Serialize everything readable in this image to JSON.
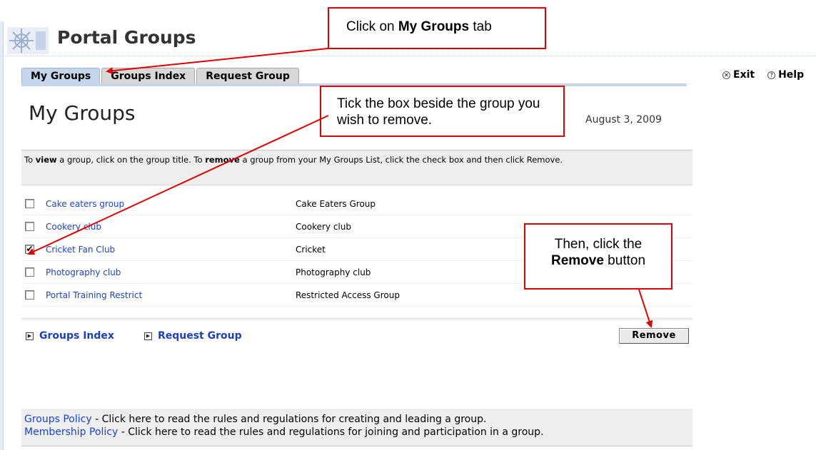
{
  "header": {
    "title": "Portal Groups"
  },
  "tabs": [
    {
      "label": "My Groups",
      "active": true
    },
    {
      "label": "Groups Index",
      "active": false
    },
    {
      "label": "Request Group",
      "active": false
    }
  ],
  "top_links": {
    "exit": "Exit",
    "help": "Help"
  },
  "page": {
    "heading": "My Groups",
    "date": "August 3, 2009"
  },
  "instructions": {
    "part1": "To ",
    "view_word": "view",
    "part2": " a group, click on the group title. To ",
    "remove_word": "remove",
    "part3": " a group from your My Groups List, click the check box and then click Remove."
  },
  "groups": [
    {
      "title": "Cake eaters group",
      "description": "Cake Eaters Group",
      "checked": false
    },
    {
      "title": "Cookery club",
      "description": "Cookery club",
      "checked": false
    },
    {
      "title": "Cricket Fan Club",
      "description": "Cricket",
      "checked": true
    },
    {
      "title": "Photography club",
      "description": "Photography club",
      "checked": false
    },
    {
      "title": "Portal Training Restrict",
      "description": "Restricted Access Group",
      "checked": false
    }
  ],
  "footer_links": {
    "groups_index": "Groups Index",
    "request_group": "Request Group"
  },
  "remove_button": "Remove",
  "policies": {
    "groups_policy_link": "Groups Policy",
    "groups_policy_text": " - Click here to read the rules and regulations for creating and leading a group.",
    "membership_policy_link": "Membership Policy",
    "membership_policy_text": " - Click here to read the rules and regulations for joining and participation in a group."
  },
  "callouts": {
    "c1_pre": "Click on ",
    "c1_bold": "My Groups",
    "c1_post": " tab",
    "c2": "Tick the box beside the group you wish to remove.",
    "c3_line1": "Then, click the",
    "c3_bold": "Remove",
    "c3_post": " button"
  },
  "colors": {
    "link": "#1a44cc",
    "active_tab": "#c5d5ec",
    "callout_border": "#e00000"
  },
  "icons": {
    "exit": "close-circle-icon",
    "help": "question-circle-icon",
    "footer": "play-square-icon"
  }
}
